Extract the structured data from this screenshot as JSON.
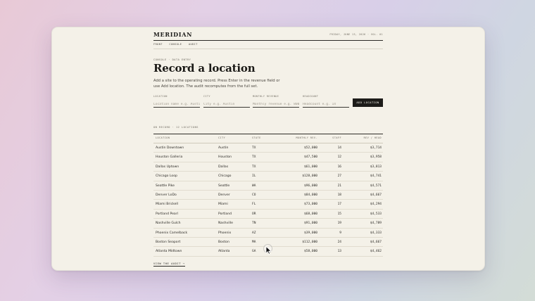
{
  "brand": "MERIDIAN",
  "dateline": "FRIDAY, JUNE 13, 2026 · VOL. 01",
  "nav": [
    "FRONT",
    "CONSOLE",
    "AUDIT"
  ],
  "eyebrow": "CONSOLE · DATA ENTRY",
  "title": "Record a location",
  "description": "Add a site to the operating record. Press Enter in the revenue field or use Add location. The audit recomputes from the full set.",
  "form": {
    "location": {
      "label": "LOCATION",
      "placeholder": "Location name e.g. Austin",
      "value": ""
    },
    "city": {
      "label": "CITY",
      "placeholder": "City e.g. Austin",
      "value": ""
    },
    "revenue": {
      "label": "MONTHLY REVENUE",
      "placeholder": "Monthly revenue e.g. 80000",
      "value": ""
    },
    "headcount": {
      "label": "HEADCOUNT",
      "placeholder": "Headcount e.g. 14",
      "value": ""
    },
    "submit": "ADD LOCATION"
  },
  "section_label": "ON RECORD · 12 LOCATIONS",
  "table": {
    "headers": {
      "location": "LOCATION",
      "city": "CITY",
      "state": "STATE",
      "revenue": "MONTHLY REV.",
      "staff": "STAFF",
      "rev_per_head": "REV / HEAD"
    },
    "rows": [
      {
        "location": "Austin Downtown",
        "city": "Austin",
        "state": "TX",
        "revenue": "$52,000",
        "staff": "14",
        "rev_per_head": "$3,714"
      },
      {
        "location": "Houston Galleria",
        "city": "Houston",
        "state": "TX",
        "revenue": "$47,500",
        "staff": "12",
        "rev_per_head": "$3,958"
      },
      {
        "location": "Dallas Uptown",
        "city": "Dallas",
        "state": "TX",
        "revenue": "$61,000",
        "staff": "16",
        "rev_per_head": "$3,813"
      },
      {
        "location": "Chicago Loop",
        "city": "Chicago",
        "state": "IL",
        "revenue": "$128,000",
        "staff": "27",
        "rev_per_head": "$4,741"
      },
      {
        "location": "Seattle Pike",
        "city": "Seattle",
        "state": "WA",
        "revenue": "$96,000",
        "staff": "21",
        "rev_per_head": "$4,571"
      },
      {
        "location": "Denver LoDo",
        "city": "Denver",
        "state": "CO",
        "revenue": "$84,000",
        "staff": "18",
        "rev_per_head": "$4,667"
      },
      {
        "location": "Miami Brickell",
        "city": "Miami",
        "state": "FL",
        "revenue": "$73,000",
        "staff": "17",
        "rev_per_head": "$4,294"
      },
      {
        "location": "Portland Pearl",
        "city": "Portland",
        "state": "OR",
        "revenue": "$68,000",
        "staff": "15",
        "rev_per_head": "$4,533"
      },
      {
        "location": "Nashville Gulch",
        "city": "Nashville",
        "state": "TN",
        "revenue": "$91,000",
        "staff": "19",
        "rev_per_head": "$4,789"
      },
      {
        "location": "Phoenix Camelback",
        "city": "Phoenix",
        "state": "AZ",
        "revenue": "$39,000",
        "staff": "9",
        "rev_per_head": "$4,333"
      },
      {
        "location": "Boston Seaport",
        "city": "Boston",
        "state": "MA",
        "revenue": "$112,000",
        "staff": "24",
        "rev_per_head": "$4,667"
      },
      {
        "location": "Atlanta Midtown",
        "city": "Atlanta",
        "state": "GA",
        "revenue": "$58,000",
        "staff": "13",
        "rev_per_head": "$4,462"
      }
    ]
  },
  "audit_link": "VIEW THE AUDIT →",
  "icons": {
    "cursor": "mouse-pointer-icon"
  }
}
